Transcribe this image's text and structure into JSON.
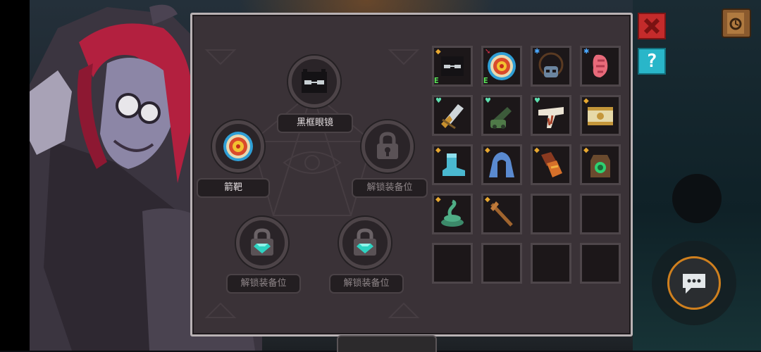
{
  "equipment_slots": {
    "top": {
      "name": "黑框眼镜",
      "item_icon": "black-frame-glasses"
    },
    "left": {
      "name": "箭靶",
      "item_icon": "archery-target"
    },
    "right": {
      "name": "解锁装备位",
      "state": "locked",
      "item_icon": "padlock-icon"
    },
    "bottom_left": {
      "name": "解锁装备位",
      "state": "locked",
      "item_icon": "gem-lock-icon"
    },
    "bottom_right": {
      "name": "解锁装备位",
      "state": "locked",
      "item_icon": "gem-lock-icon"
    }
  },
  "inventory": {
    "rows": [
      [
        {
          "icon": "black-frame-glasses",
          "badge": "E",
          "corner": "gold-shield"
        },
        {
          "icon": "archery-target",
          "badge": "E",
          "corner": "red-arrow"
        },
        {
          "icon": "skull-necklace",
          "badge": "",
          "corner": "blue-star"
        },
        {
          "icon": "raw-meat",
          "badge": "",
          "corner": "blue-star"
        }
      ],
      [
        {
          "icon": "steel-claw",
          "badge": "",
          "corner": "green-heart"
        },
        {
          "icon": "green-cannon",
          "badge": "",
          "corner": "green-heart"
        },
        {
          "icon": "bone-jaw",
          "badge": "",
          "corner": "green-heart"
        },
        {
          "icon": "ancient-scroll",
          "badge": "",
          "corner": "gold-shield"
        }
      ],
      [
        {
          "icon": "ice-boot",
          "badge": "",
          "corner": "gold-shield"
        },
        {
          "icon": "blue-cloak",
          "badge": "",
          "corner": "gold-shield"
        },
        {
          "icon": "fire-gauntlet",
          "badge": "",
          "corner": "gold-shield"
        },
        {
          "icon": "emerald-pouch",
          "badge": "",
          "corner": "gold-shield"
        }
      ],
      [
        {
          "icon": "jade-snake",
          "badge": "",
          "corner": "gold-shield"
        },
        {
          "icon": "wooden-staff",
          "badge": "",
          "corner": "gold-shield"
        },
        {
          "icon": "",
          "badge": "",
          "corner": ""
        },
        {
          "icon": "",
          "badge": "",
          "corner": ""
        }
      ],
      [
        {
          "icon": "",
          "badge": "",
          "corner": ""
        },
        {
          "icon": "",
          "badge": "",
          "corner": ""
        },
        {
          "icon": "",
          "badge": "",
          "corner": ""
        },
        {
          "icon": "",
          "badge": "",
          "corner": ""
        }
      ]
    ]
  },
  "hud": {
    "close_icon": "close-x-icon",
    "help_label": "?",
    "journal_icon": "journal-icon",
    "chat_icon": "chat-bubble-icon"
  },
  "colors": {
    "panel_bg": "#3a3237",
    "panel_border": "#b9b2b4",
    "badge_e": "#5cf05c",
    "close_red": "#c42b2b",
    "help_cyan": "#29b6c9"
  }
}
